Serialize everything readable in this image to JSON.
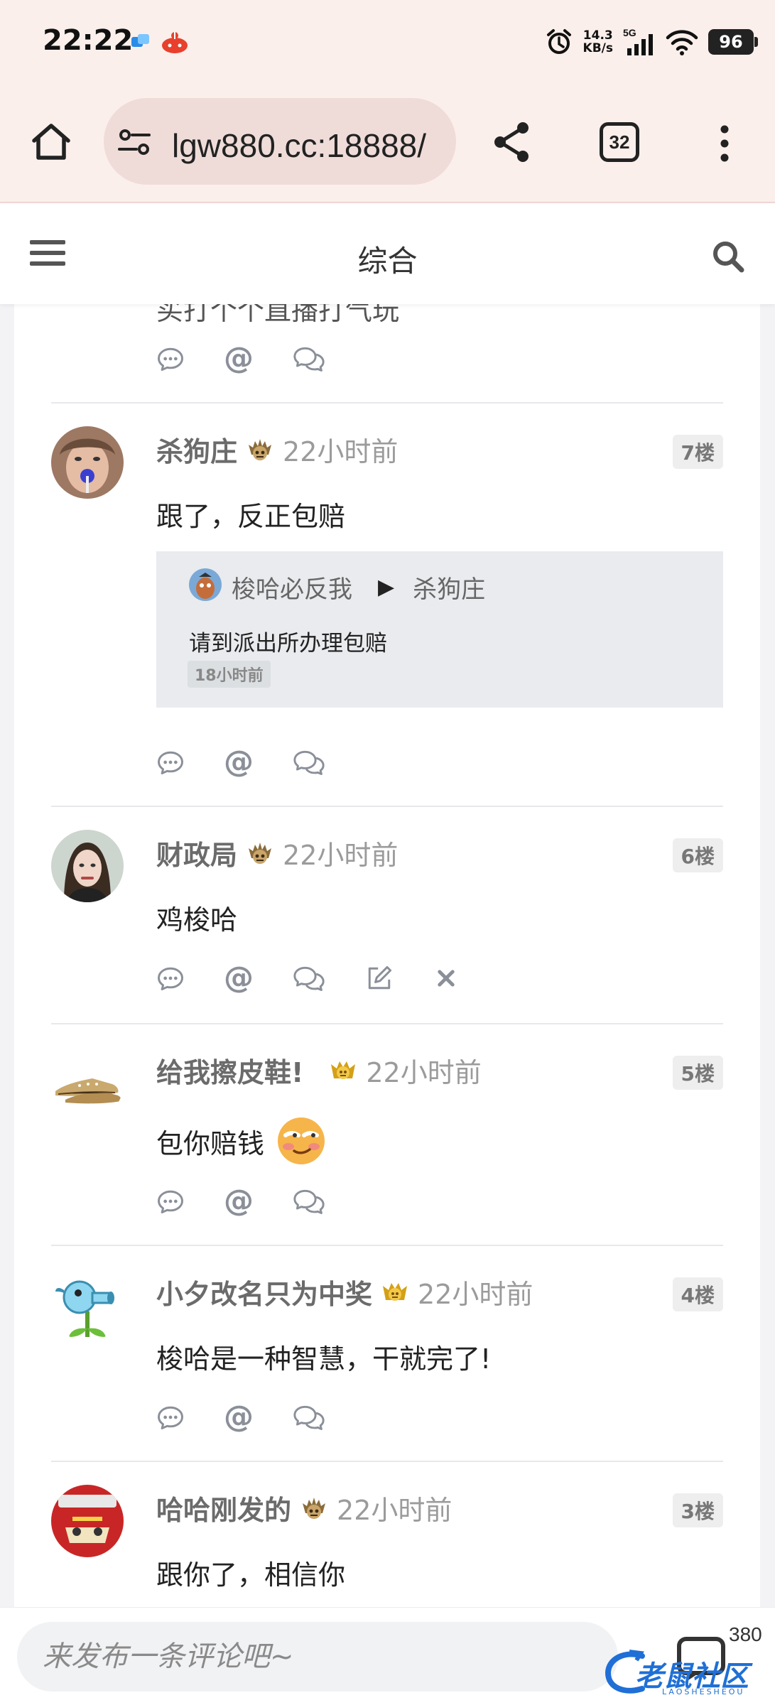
{
  "status_bar": {
    "time": "22:22",
    "net_speed_value": "14.3",
    "net_speed_unit": "KB/s",
    "network": "5G",
    "battery": "96"
  },
  "browser": {
    "url": "lgw880.cc:18888/",
    "tab_count": "32"
  },
  "header": {
    "title": "综合"
  },
  "partial_comment": {
    "text": "买打个个直播打气玩"
  },
  "comments": [
    {
      "username": "杀狗庄",
      "time": "22小时前",
      "floor": "7楼",
      "body": "跟了，反正包赔",
      "quote": {
        "author": "梭哈必反我",
        "arrow": "▶",
        "reply_to": "杀狗庄",
        "body": "请到派出所办理包赔",
        "time": "18小时前"
      }
    },
    {
      "username": "财政局",
      "time": "22小时前",
      "floor": "6楼",
      "body": "鸡梭哈"
    },
    {
      "username": "给我擦皮鞋!",
      "time": "22小时前",
      "floor": "5楼",
      "body": "包你赔钱"
    },
    {
      "username": "小夕改名只为中奖",
      "time": "22小时前",
      "floor": "4楼",
      "body": "梭哈是一种智慧，干就完了!"
    },
    {
      "username": "哈哈刚发的",
      "time": "22小时前",
      "floor": "3楼",
      "body": "跟你了，相信你"
    }
  ],
  "bottom_bar": {
    "placeholder": "来发布一条评论吧~",
    "comment_count": "380",
    "watermark": "老鼠社区",
    "watermark_sub": "LAOSHESHEOU"
  },
  "colors": {
    "accent_blue": "#1f6fd6",
    "username_gray": "#6b6b6b",
    "time_gray": "#9b9b9b",
    "browser_bg": "#fbefeb"
  },
  "icons": [
    "home-icon",
    "tune-icon",
    "share-icon",
    "more-icon",
    "menu-icon",
    "search-icon",
    "comment-icon",
    "mention-icon",
    "chat-icon",
    "edit-icon",
    "delete-icon"
  ]
}
